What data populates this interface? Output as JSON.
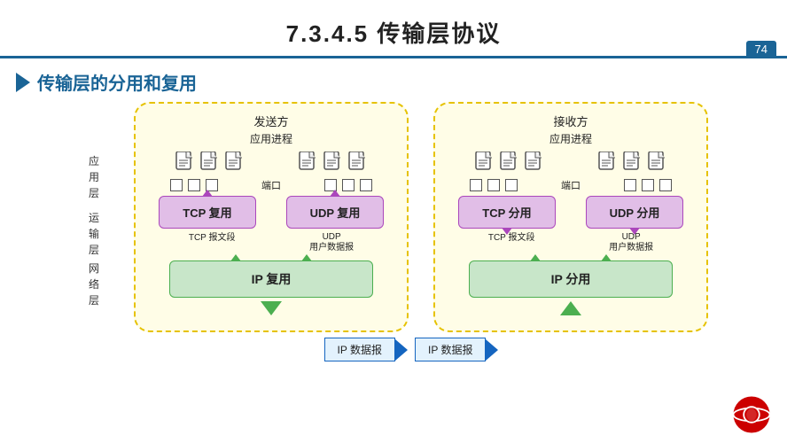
{
  "header": {
    "title": "7.3.4.5    传输层协议",
    "page_number": "74"
  },
  "section": {
    "title": "传输层的分用和复用"
  },
  "left_diagram": {
    "title": "发送方",
    "subtitle": "应用进程",
    "port_label": "端口",
    "tcp_label": "TCP 复用",
    "udp_label": "UDP 复用",
    "ip_label": "IP 复用",
    "tcp_seg": "TCP 报文段",
    "udp_seg": "UDP",
    "udp_seg2": "用户数据报",
    "direction": "down"
  },
  "right_diagram": {
    "title": "接收方",
    "subtitle": "应用进程",
    "port_label": "端口",
    "tcp_label": "TCP 分用",
    "udp_label": "UDP 分用",
    "ip_label": "IP 分用",
    "tcp_seg": "TCP 报文段",
    "udp_seg": "UDP",
    "udp_seg2": "用户数据报",
    "direction": "up"
  },
  "layers": {
    "app": "应\n用\n层",
    "transport": "运\n输\n层",
    "network": "网\n络\n层"
  },
  "ip_data": {
    "left_label": "IP 数据报",
    "right_label": "IP 数据报",
    "arrow": "→"
  }
}
